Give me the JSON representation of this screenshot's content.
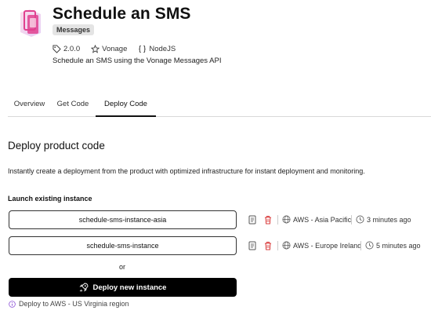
{
  "product": {
    "title": "Schedule an SMS",
    "badge": "Messages",
    "version": "2.0.0",
    "vendor": "Vonage",
    "language": "NodeJS",
    "description": "Schedule an SMS using the Vonage Messages API"
  },
  "tabs": [
    {
      "label": "Overview",
      "active": false
    },
    {
      "label": "Get Code",
      "active": false
    },
    {
      "label": "Deploy Code",
      "active": true
    }
  ],
  "deploy": {
    "title": "Deploy product code",
    "description": "Instantly create a deployment from the product with optimized infrastructure for instant deployment and monitoring.",
    "launch_label": "Launch existing instance",
    "instances": [
      {
        "name": "schedule-sms-instance-asia",
        "region": "AWS - Asia Pacific",
        "time": "3 minutes ago"
      },
      {
        "name": "schedule-sms-instance",
        "region": "AWS - Europe Ireland",
        "time": "5 minutes ago"
      }
    ],
    "or_text": "or",
    "new_button": "Deploy new instance",
    "region_note": "Deploy to AWS - US Virginia region"
  },
  "colors": {
    "logo_pink": "#e0418f",
    "logo_purple": "#9b3fd6",
    "delete_red": "#d93b3b",
    "info_purple": "#8a4fd6"
  },
  "icons": {
    "version": "tag-icon",
    "vendor": "star-icon",
    "language": "code-braces-icon",
    "copy": "document-icon",
    "delete": "trash-icon",
    "region": "globe-icon",
    "time": "clock-icon",
    "deploy": "rocket-icon",
    "info": "info-icon"
  }
}
